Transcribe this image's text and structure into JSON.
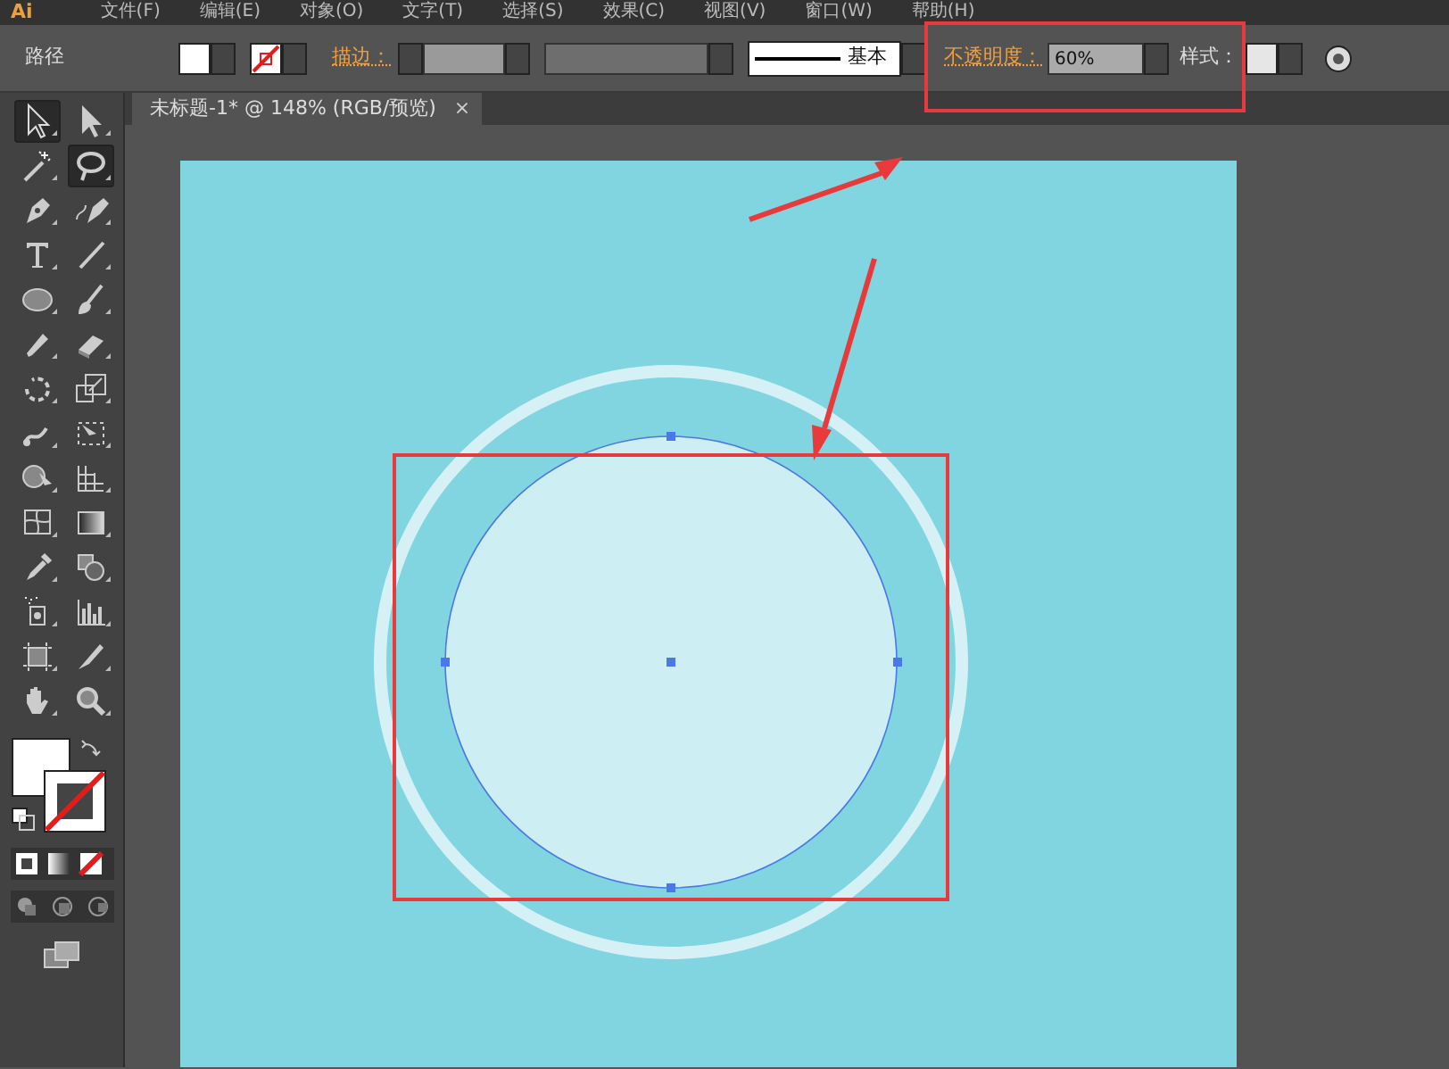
{
  "menu_bar": {
    "logo": "Ai",
    "items": [
      "文件(F)",
      "编辑(E)",
      "对象(O)",
      "文字(T)",
      "选择(S)",
      "效果(C)",
      "视图(V)",
      "窗口(W)",
      "帮助(H)"
    ]
  },
  "control_bar": {
    "object_type": "路径",
    "stroke_label": "描边：",
    "stroke_profile": "基本",
    "opacity_label": "不透明度：",
    "opacity_value": "60%",
    "style_label": "样式："
  },
  "document_tab": {
    "title": "未标题-1* @ 148% (RGB/预览)",
    "close": "×"
  },
  "tools": [
    {
      "kind": "selection",
      "selected": true
    },
    {
      "kind": "direct-selection",
      "selected": false
    },
    {
      "kind": "magic-wand",
      "selected": false
    },
    {
      "kind": "lasso",
      "selected": true
    },
    {
      "kind": "pen",
      "selected": false
    },
    {
      "kind": "curvature-pen",
      "selected": false
    },
    {
      "kind": "type",
      "selected": false
    },
    {
      "kind": "line",
      "selected": false
    },
    {
      "kind": "ellipse",
      "selected": false
    },
    {
      "kind": "brush",
      "selected": false
    },
    {
      "kind": "pencil",
      "selected": false
    },
    {
      "kind": "eraser",
      "selected": false
    },
    {
      "kind": "rotate",
      "selected": false
    },
    {
      "kind": "scale",
      "selected": false
    },
    {
      "kind": "warp",
      "selected": false
    },
    {
      "kind": "free-transform",
      "selected": false
    },
    {
      "kind": "shape-builder",
      "selected": false
    },
    {
      "kind": "perspective",
      "selected": false
    },
    {
      "kind": "mesh",
      "selected": false
    },
    {
      "kind": "gradient",
      "selected": false
    },
    {
      "kind": "eyedropper",
      "selected": false
    },
    {
      "kind": "blend",
      "selected": false
    },
    {
      "kind": "sprayer",
      "selected": false
    },
    {
      "kind": "graph",
      "selected": false
    },
    {
      "kind": "artboard",
      "selected": false
    },
    {
      "kind": "slice",
      "selected": false
    },
    {
      "kind": "hand",
      "selected": false
    },
    {
      "kind": "zoom",
      "selected": false
    }
  ]
}
